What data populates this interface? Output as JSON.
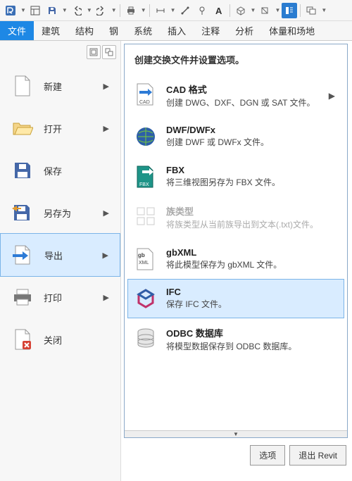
{
  "tabs": [
    "文件",
    "建筑",
    "结构",
    "钢",
    "系统",
    "插入",
    "注释",
    "分析",
    "体量和场地"
  ],
  "activeTab": "文件",
  "menu": [
    {
      "label": "新建",
      "arrow": true
    },
    {
      "label": "打开",
      "arrow": true
    },
    {
      "label": "保存",
      "arrow": false
    },
    {
      "label": "另存为",
      "arrow": true
    },
    {
      "label": "导出",
      "arrow": true,
      "selected": true
    },
    {
      "label": "打印",
      "arrow": true
    },
    {
      "label": "关闭",
      "arrow": false
    }
  ],
  "panel": {
    "head": "创建交换文件并设置选项。",
    "items": [
      {
        "title": "CAD 格式",
        "desc": "创建 DWG、DXF、DGN 或 SAT 文件。",
        "arrow": true
      },
      {
        "title": "DWF/DWFx",
        "desc": "创建 DWF 或 DWFx 文件。"
      },
      {
        "title": "FBX",
        "desc": "将三维视图另存为 FBX 文件。"
      },
      {
        "title": "族类型",
        "desc": "将族类型从当前族导出到文本(.txt)文件。",
        "disabled": true
      },
      {
        "title": "gbXML",
        "desc": "将此模型保存为 gbXML 文件。"
      },
      {
        "title": "IFC",
        "desc": "保存 IFC 文件。",
        "selected": true
      },
      {
        "title": "ODBC 数据库",
        "desc": "将模型数据保存到 ODBC 数据库。"
      }
    ]
  },
  "footer": {
    "options": "选项",
    "exit": "退出 Revit"
  }
}
